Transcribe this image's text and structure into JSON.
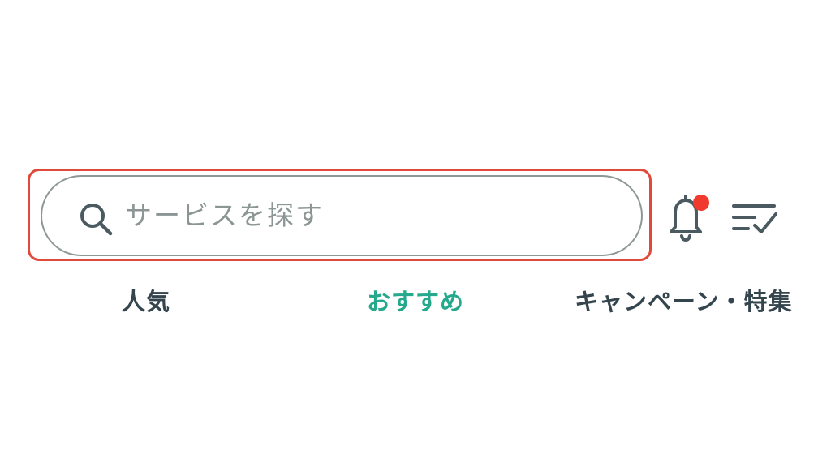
{
  "search": {
    "placeholder": "サービスを探す",
    "icon": "search-icon"
  },
  "header_actions": {
    "notifications": {
      "icon": "bell-icon",
      "has_unread": true,
      "dot_color": "#f03a2e"
    },
    "checklist": {
      "icon": "checklist-icon"
    }
  },
  "tabs": [
    {
      "label": "人気",
      "active": false
    },
    {
      "label": "おすすめ",
      "active": true
    },
    {
      "label": "キャンペーン・特集",
      "active": false
    }
  ],
  "colors": {
    "accent": "#25a98c",
    "tab_text": "#34454e",
    "highlight_border": "#e04a3a",
    "search_border": "#8d9896",
    "placeholder_text": "#8b9593"
  }
}
